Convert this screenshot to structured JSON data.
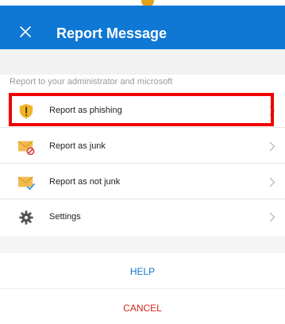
{
  "header": {
    "title": "Report Message",
    "close_icon": "close-icon",
    "background": "#0f78d4"
  },
  "section": {
    "label": "Report to your administrator and microsoft"
  },
  "options": [
    {
      "label": "Report as phishing",
      "icon": "shield-warning-icon",
      "highlighted": true
    },
    {
      "label": "Report as junk",
      "icon": "junk-mail-icon"
    },
    {
      "label": "Report as not junk",
      "icon": "not-junk-mail-icon"
    },
    {
      "label": "Settings",
      "icon": "gear-icon"
    }
  ],
  "actions": {
    "help": "HELP",
    "cancel": "CANCEL",
    "help_color": "#1277d1",
    "cancel_color": "#d0271b"
  },
  "highlight_color": "#ef0000"
}
